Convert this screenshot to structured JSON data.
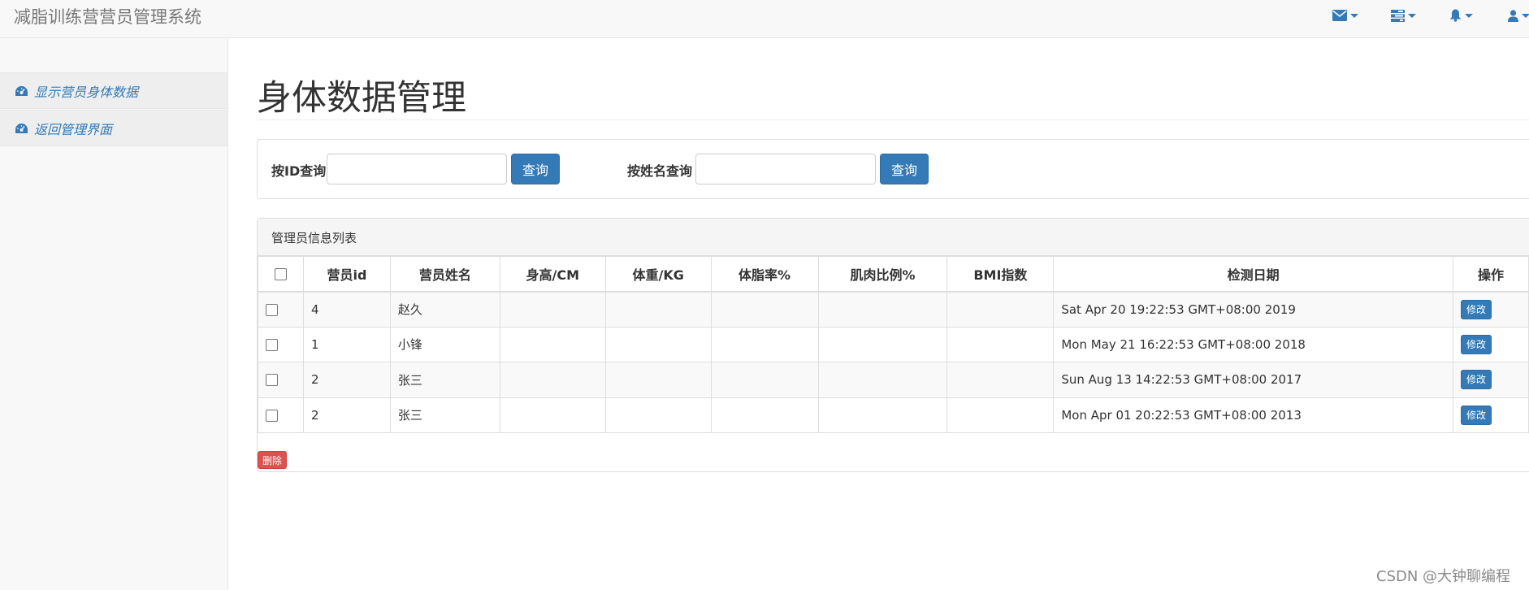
{
  "navbar": {
    "brand": "减脂训练营营员管理系统",
    "icons": [
      "envelope-icon",
      "tasks-icon",
      "bell-icon",
      "user-icon"
    ]
  },
  "sidebar": {
    "items": [
      {
        "label": "显示营员身体数据",
        "icon": "dashboard-icon"
      },
      {
        "label": "返回管理界面",
        "icon": "dashboard-icon"
      }
    ]
  },
  "page": {
    "title": "身体数据管理"
  },
  "search": {
    "by_id_label": "按ID查询",
    "by_id_value": "",
    "by_id_button": "查询",
    "by_name_label": "按姓名查询",
    "by_name_value": "",
    "by_name_button": "查询"
  },
  "list": {
    "heading": "管理员信息列表",
    "columns": [
      "营员id",
      "营员姓名",
      "身高/CM",
      "体重/KG",
      "体脂率%",
      "肌肉比例%",
      "BMI指数",
      "检测日期",
      "操作"
    ],
    "rows": [
      {
        "id": "4",
        "name": "赵久",
        "height": "",
        "weight": "",
        "bodyfat": "",
        "muscle": "",
        "bmi": "",
        "date": "Sat Apr 20 19:22:53 GMT+08:00 2019",
        "action": "修改"
      },
      {
        "id": "1",
        "name": "小锋",
        "height": "",
        "weight": "",
        "bodyfat": "",
        "muscle": "",
        "bmi": "",
        "date": "Mon May 21 16:22:53 GMT+08:00 2018",
        "action": "修改"
      },
      {
        "id": "2",
        "name": "张三",
        "height": "",
        "weight": "",
        "bodyfat": "",
        "muscle": "",
        "bmi": "",
        "date": "Sun Aug 13 14:22:53 GMT+08:00 2017",
        "action": "修改"
      },
      {
        "id": "2",
        "name": "张三",
        "height": "",
        "weight": "",
        "bodyfat": "",
        "muscle": "",
        "bmi": "",
        "date": "Mon Apr 01 20:22:53 GMT+08:00 2013",
        "action": "修改"
      }
    ],
    "delete_button": "删除"
  },
  "watermark": "CSDN @大钟聊编程",
  "colors": {
    "primary": "#337ab7",
    "danger": "#d9534f",
    "navbar_bg": "#f8f8f8"
  }
}
